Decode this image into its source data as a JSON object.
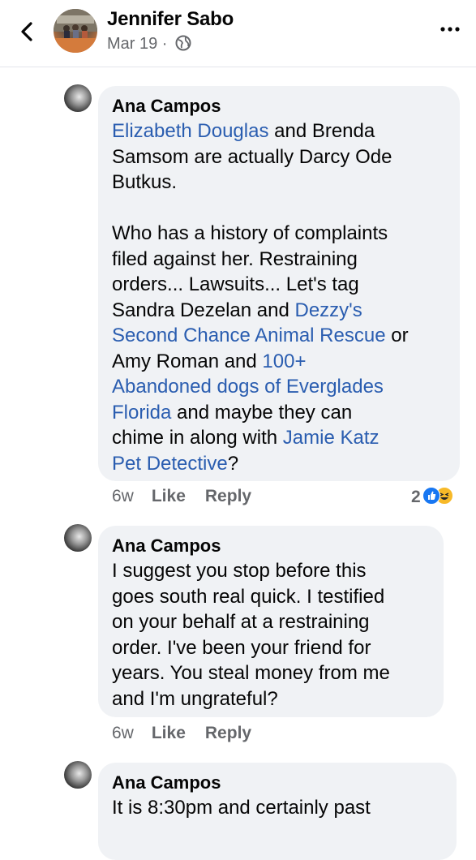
{
  "header": {
    "name": "Jennifer Sabo",
    "date": "Mar 19 ·"
  },
  "comments": [
    {
      "author": "Ana Campos",
      "parts": [
        {
          "t": "Elizabeth Douglas",
          "link": true
        },
        {
          "t": " and Brenda\nSamsom are actually Darcy Ode\nButkus.\n\nWho has a history of complaints\nfiled against her. Restraining\norders... Lawsuits... Let's tag\nSandra Dezelan and "
        },
        {
          "t": "Dezzy's\nSecond Chance Animal Rescue",
          "link": true
        },
        {
          "t": " or\nAmy Roman and "
        },
        {
          "t": "100+\nAbandoned dogs of Everglades\nFlorida",
          "link": true
        },
        {
          "t": " and maybe they can\nchime in along with "
        },
        {
          "t": "Jamie Katz\nPet Detective",
          "link": true
        },
        {
          "t": "?"
        }
      ],
      "time": "6w",
      "like": "Like",
      "reply": "Reply",
      "reaction_count": "2"
    },
    {
      "author": "Ana Campos",
      "parts": [
        {
          "t": "I suggest you stop before this\ngoes south real quick. I testified\non your behalf at a restraining\norder. I've been your friend for\nyears. You steal money from me\nand I'm ungrateful?"
        }
      ],
      "time": "6w",
      "like": "Like",
      "reply": "Reply"
    },
    {
      "author": "Ana Campos",
      "parts": [
        {
          "t": "It is 8:30pm and certainly past"
        }
      ]
    }
  ],
  "colors": {
    "link": "#2a5db0",
    "bubble": "#f0f2f5",
    "muted": "#65676b"
  },
  "icons": [
    "back-chevron-icon",
    "globe-icon",
    "more-options-icon",
    "like-reaction-icon",
    "haha-reaction-icon"
  ]
}
